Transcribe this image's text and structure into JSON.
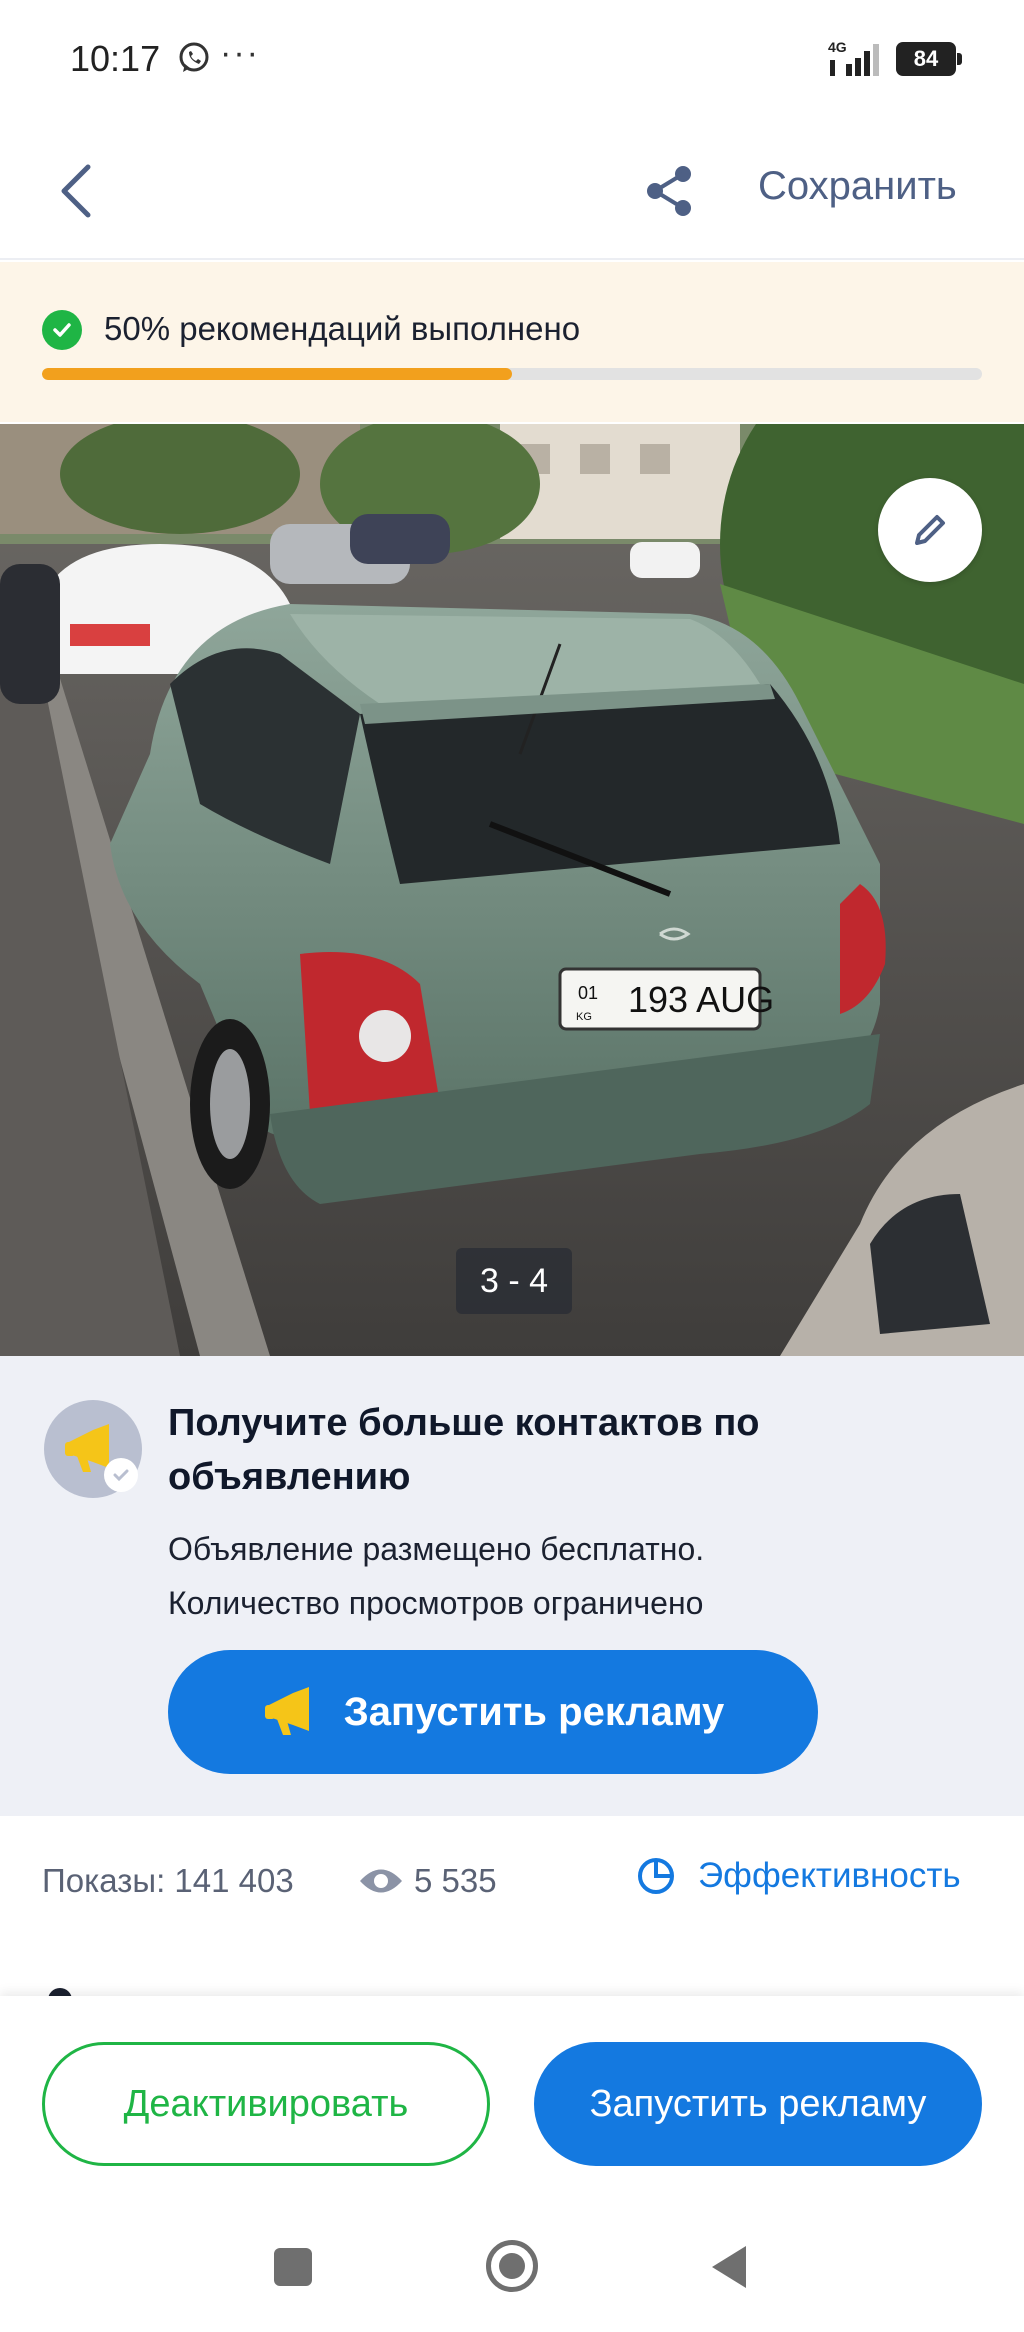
{
  "status_bar": {
    "time": "10:17",
    "more": "···",
    "network": "4G",
    "battery": "84"
  },
  "header": {
    "back_icon": "chevron-left-icon",
    "share_icon": "share-icon",
    "save_label": "Сохранить"
  },
  "recommendations": {
    "text": "50% рекомендаций выполнено",
    "progress_percent": 50,
    "progress_color": "#f2a01d",
    "check_color": "#1fb545"
  },
  "photo": {
    "counter": "3 - 4",
    "plate": {
      "region": "01",
      "country": "KG",
      "number": "193 AUG"
    },
    "edit_icon": "pencil-icon"
  },
  "promo": {
    "title": "Получите больше контактов по объявлению",
    "description_line1": "Объявление размещено бесплатно.",
    "description_line2": "Количество просмотров ограничено",
    "button_label": "Запустить рекламу",
    "icon": "megaphone-icon"
  },
  "stats": {
    "impressions": "Показы: 141 403",
    "views": "5 535",
    "effectiveness": "Эффективность"
  },
  "bottom_bar": {
    "deactivate_label": "Деактивировать",
    "advertise_label": "Запустить рекламу"
  },
  "colors": {
    "accent_blue": "#1479e0",
    "green": "#1fb545",
    "header_text": "#4e6085"
  }
}
